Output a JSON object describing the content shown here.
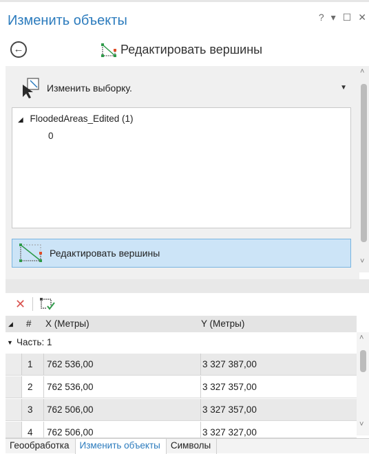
{
  "window": {
    "title": "Изменить объекты",
    "controls": [
      "?",
      "▾",
      "☐",
      "✕"
    ]
  },
  "header": {
    "back_icon": "back-arrow-circle-icon",
    "tool_title": "Редактировать вершины"
  },
  "selection": {
    "change_selection_label": "Изменить выборку.",
    "tree": {
      "layer": "FloodedAreas_Edited (1)",
      "feature_id": "0"
    }
  },
  "edit_button": {
    "label": "Редактировать вершины"
  },
  "grid": {
    "columns": {
      "num": "#",
      "x": "X (Метры)",
      "y": "Y (Метры)"
    },
    "part_label": "Часть: 1",
    "rows": [
      {
        "n": "1",
        "x": "762 536,00",
        "y": "3 327 387,00"
      },
      {
        "n": "2",
        "x": "762 536,00",
        "y": "3 327 357,00"
      },
      {
        "n": "3",
        "x": "762 506,00",
        "y": "3 327 357,00"
      },
      {
        "n": "4",
        "x": "762 506,00",
        "y": "3 327 327,00"
      }
    ]
  },
  "tabs": [
    {
      "label": "Геообработка",
      "active": false
    },
    {
      "label": "Изменить объекты",
      "active": true
    },
    {
      "label": "Символы",
      "active": false
    }
  ]
}
